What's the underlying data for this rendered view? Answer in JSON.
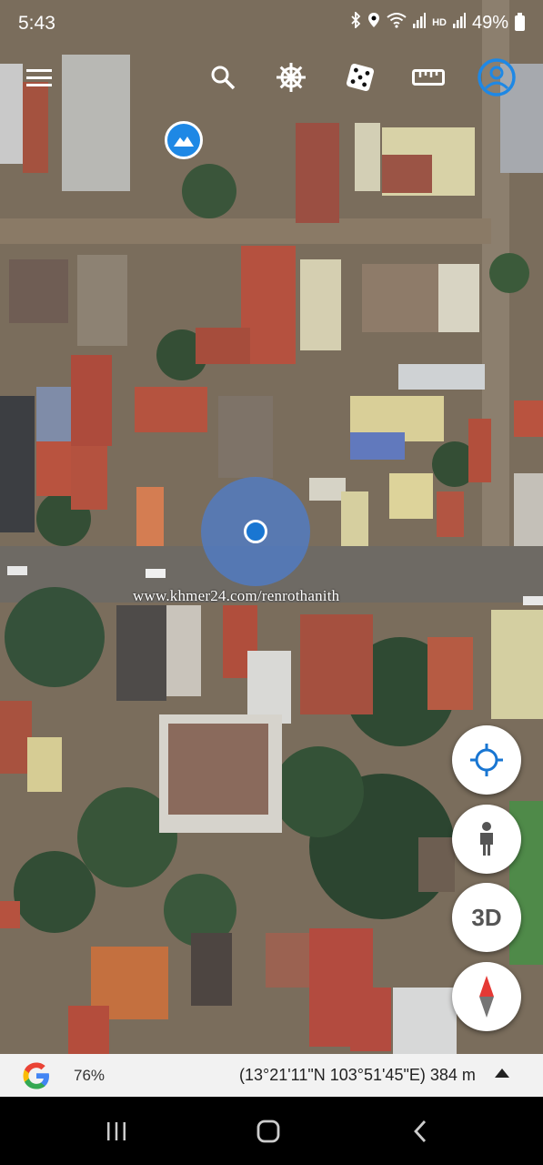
{
  "status_bar": {
    "time": "5:43",
    "icons": [
      "bluetooth-icon",
      "location-pin-icon",
      "wifi-icon",
      "signal-icon",
      "signal-icon",
      "battery-icon"
    ],
    "hd_label": "HD",
    "battery": "49%"
  },
  "toolbar": {
    "buttons": [
      "menu-icon",
      "search-icon",
      "voyager-ship-wheel-icon",
      "feeling-lucky-dice-icon",
      "measure-ruler-icon",
      "account-icon"
    ]
  },
  "map": {
    "photos_button": "mountain-photo-icon",
    "watermark": "www.khmer24.com/renrothanith"
  },
  "fab": {
    "my_location": "crosshair-icon",
    "street_view": "pegman-icon",
    "mode_3d_label": "3D",
    "compass": "compass-icon"
  },
  "bottom_bar": {
    "logo": "google-g-logo",
    "zoom": "76%",
    "coordinates": "(13°21'11\"N 103°51'45\"E) 384 m"
  },
  "nav_bar": {
    "buttons": [
      "recents-icon",
      "home-icon",
      "back-icon"
    ]
  },
  "colors": {
    "accent_blue": "#1976d2",
    "location_halo": "#4d7dcd",
    "compass_red": "#e53935",
    "bottom_bar_bg": "#f2f2f2"
  }
}
